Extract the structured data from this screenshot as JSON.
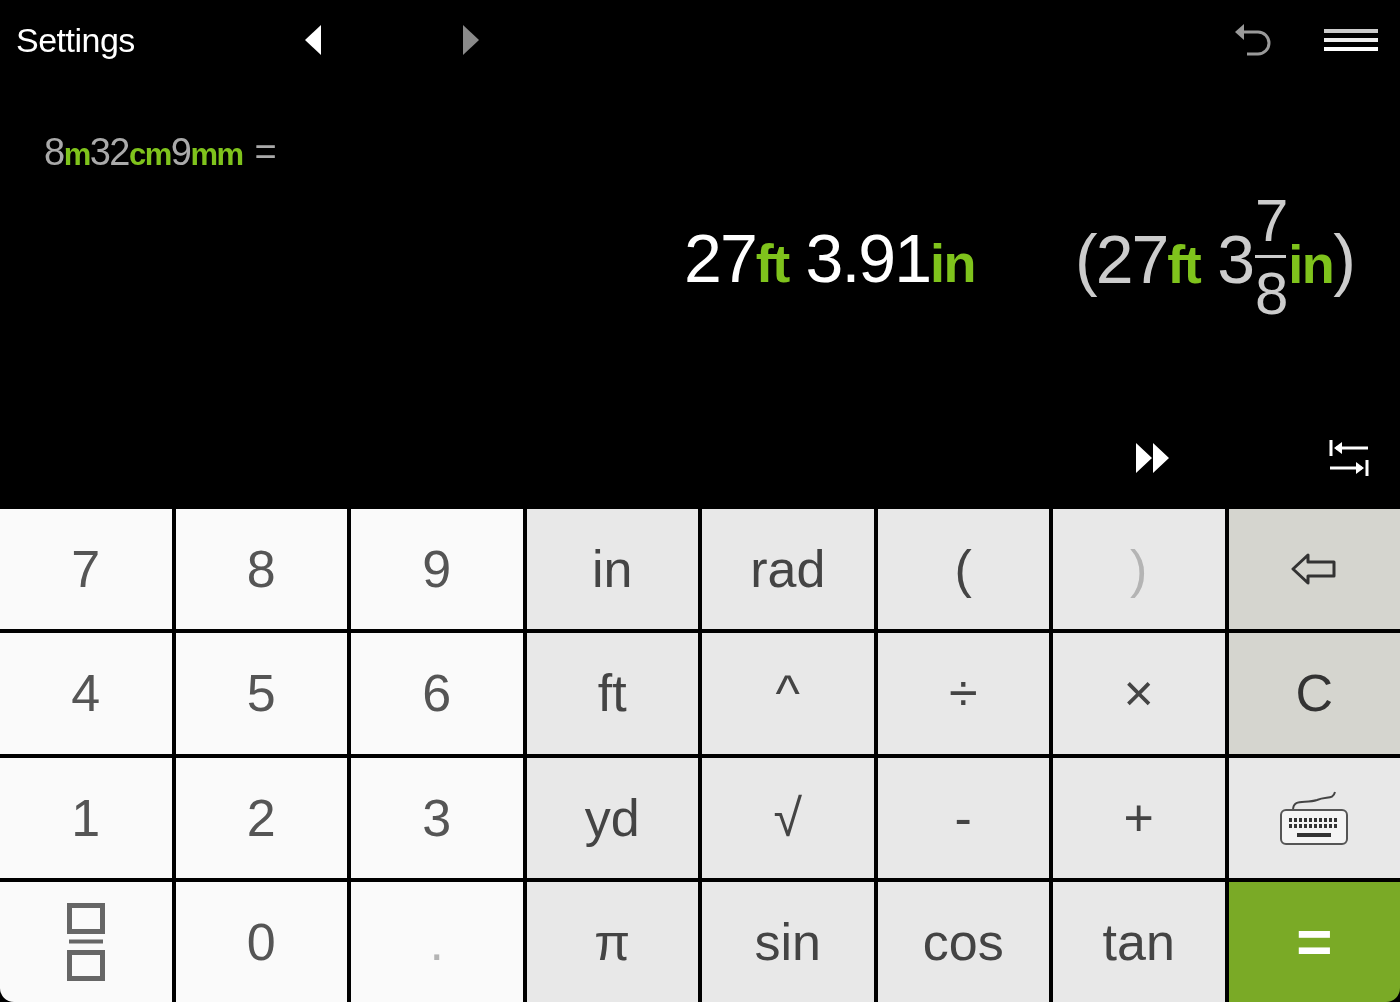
{
  "header": {
    "settings_link": "Settings",
    "history_nav": [
      {
        "disabled": false
      },
      {
        "disabled": true
      }
    ]
  },
  "expression": {
    "parts": [
      {
        "value": "8",
        "unit": "m"
      },
      {
        "value": "32",
        "unit": "cm"
      },
      {
        "value": "9",
        "unit": "mm"
      }
    ],
    "equals": "="
  },
  "result": {
    "parts": [
      {
        "value": "27",
        "unit": "ft"
      },
      {
        "value": "3.91",
        "unit": "in"
      }
    ]
  },
  "fraction_result": {
    "open": "(",
    "parts": [
      {
        "value": "27",
        "unit": "ft"
      },
      {
        "value": "3",
        "numerator": "7",
        "denominator": "8",
        "unit": "in"
      }
    ],
    "close": ")"
  },
  "keys": [
    {
      "kind": "digit",
      "label": "7",
      "disabled": false
    },
    {
      "kind": "digit",
      "label": "8",
      "disabled": false
    },
    {
      "kind": "digit",
      "label": "9",
      "disabled": false
    },
    {
      "kind": "function",
      "label": "in",
      "disabled": false
    },
    {
      "kind": "function",
      "label": "rad",
      "disabled": false
    },
    {
      "kind": "function",
      "label": "(",
      "disabled": false
    },
    {
      "kind": "function",
      "label": ")",
      "disabled": true
    },
    {
      "kind": "backspace",
      "disabled": false
    },
    {
      "kind": "digit",
      "label": "4",
      "disabled": false
    },
    {
      "kind": "digit",
      "label": "5",
      "disabled": false
    },
    {
      "kind": "digit",
      "label": "6",
      "disabled": false
    },
    {
      "kind": "function",
      "label": "ft",
      "disabled": false
    },
    {
      "kind": "function",
      "label": "^",
      "disabled": false
    },
    {
      "kind": "function",
      "label": "÷",
      "disabled": false
    },
    {
      "kind": "function",
      "label": "×",
      "disabled": false
    },
    {
      "kind": "edit",
      "label": "C",
      "disabled": false
    },
    {
      "kind": "digit",
      "label": "1",
      "disabled": false
    },
    {
      "kind": "digit",
      "label": "2",
      "disabled": false
    },
    {
      "kind": "digit",
      "label": "3",
      "disabled": false
    },
    {
      "kind": "function",
      "label": "yd",
      "disabled": false
    },
    {
      "kind": "function",
      "label": "√",
      "disabled": false
    },
    {
      "kind": "function",
      "label": "-",
      "disabled": false
    },
    {
      "kind": "function",
      "label": "+",
      "disabled": false
    },
    {
      "kind": "keyboard",
      "disabled": false
    },
    {
      "kind": "fraction",
      "disabled": false
    },
    {
      "kind": "digit",
      "label": "0",
      "disabled": false
    },
    {
      "kind": "decimal",
      "label": ".",
      "disabled": true
    },
    {
      "kind": "function",
      "label": "π",
      "disabled": false
    },
    {
      "kind": "function",
      "label": "sin",
      "disabled": false
    },
    {
      "kind": "function",
      "label": "cos",
      "disabled": false
    },
    {
      "kind": "function",
      "label": "tan",
      "disabled": false
    },
    {
      "kind": "equals",
      "label": "=",
      "disabled": false
    }
  ]
}
